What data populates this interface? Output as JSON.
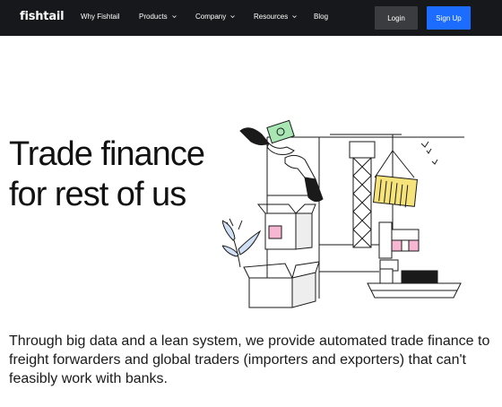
{
  "nav": {
    "logo": "fishtail",
    "items": [
      {
        "label": "Why Fishtail",
        "dropdown": false
      },
      {
        "label": "Products",
        "dropdown": true
      },
      {
        "label": "Company",
        "dropdown": true
      },
      {
        "label": "Resources",
        "dropdown": true
      },
      {
        "label": "Blog",
        "dropdown": false
      }
    ],
    "login_label": "Login",
    "signup_label": "Sign Up"
  },
  "hero": {
    "title_line1": "Trade finance",
    "title_line2": "for rest of us",
    "description": "Through big data and a lean system, we provide automated trade finance to freight forwarders and global traders (importers and exporters) that can't feasibly work with banks."
  },
  "colors": {
    "nav_bg": "#16181b",
    "login_bg": "#3a3c3f",
    "signup_bg": "#1c6dff",
    "container_yellow": "#f6e37a",
    "money_green": "#a8e6b4",
    "pink_accent": "#f7b6d2"
  }
}
